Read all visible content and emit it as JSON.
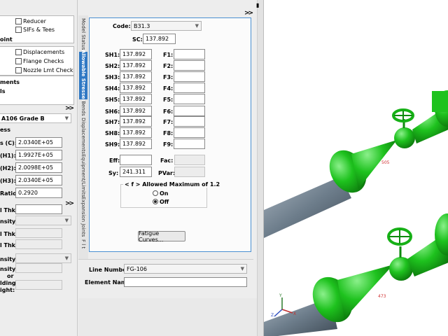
{
  "left_panel": {
    "checkboxes_top": [
      "Reducer",
      "SIFs & Tees"
    ],
    "partial_label_int": "oint",
    "checkboxes_mid": [
      "Displacements",
      "Flange Checks",
      "Nozzle Lmt Check"
    ],
    "partial_labels_1": [
      "ments",
      "ls"
    ],
    "material_value": "A106 Grade B",
    "section_label": "ess",
    "props": [
      {
        "label": "s (C):",
        "value": "2.0340E+05"
      },
      {
        "label": "(H1):",
        "value": "1.9927E+05"
      },
      {
        "label": "(H2):",
        "value": "2.0098E+05"
      },
      {
        "label": "(H3):",
        "value": "2.0340E+05"
      },
      {
        "label": "Ratio:",
        "value": "0.2920"
      }
    ],
    "thk_label": "l Thk:",
    "density_label": "nsity:",
    "thk2_label": "l Thk:",
    "thk3_label": "l Thk:",
    "density2_label": "nsity:",
    "bottom_labels": [
      "nsity:",
      "or",
      "lding",
      "ight:"
    ]
  },
  "tabs": [
    "Model Status",
    "Allowable Stresses",
    "Bends",
    "Displacements",
    "Equipment/Limits",
    "Expansion Joints",
    "F l t"
  ],
  "allowables": {
    "code_label": "Code:",
    "code_value": "B31.3",
    "sc_label": "SC:",
    "sc_value": "137.892",
    "sh_rows": [
      {
        "label": "SH1:",
        "value": "137.892",
        "f": "F1:"
      },
      {
        "label": "SH2:",
        "value": "137.892",
        "f": "F2:"
      },
      {
        "label": "SH3:",
        "value": "137.892",
        "f": "F3:"
      },
      {
        "label": "SH4:",
        "value": "137.892",
        "f": "F4:"
      },
      {
        "label": "SH5:",
        "value": "137.892",
        "f": "F5:"
      },
      {
        "label": "SH6:",
        "value": "137.892",
        "f": "F6:"
      },
      {
        "label": "SH7:",
        "value": "137.892",
        "f": "F7:"
      },
      {
        "label": "SH8:",
        "value": "137.892",
        "f": "F8:"
      },
      {
        "label": "SH9:",
        "value": "137.892",
        "f": "F9:"
      }
    ],
    "eff_label": "Eff:",
    "fac_label": "Fac:",
    "sy_label": "Sy:",
    "sy_value": "241.311",
    "pvar_label": "PVar:",
    "allowed_max_title": "< f > Allowed Maximum of 1.2",
    "radio_on": "On",
    "radio_off": "Off",
    "fatigue_button": "Fatigue Curves..."
  },
  "bottom": {
    "line_number_label": "Line Number",
    "line_number_value": "FG-106",
    "element_name_label": "Element Name",
    "element_name_value": ""
  },
  "viewer": {
    "node_labels": [
      "505",
      "473"
    ],
    "triad": {
      "x": "X",
      "y": "Y",
      "z": "Z"
    }
  },
  "colors": {
    "accent": "#2f78c4",
    "pipe": "#6f7f8c",
    "valve": "#1ec21e"
  }
}
